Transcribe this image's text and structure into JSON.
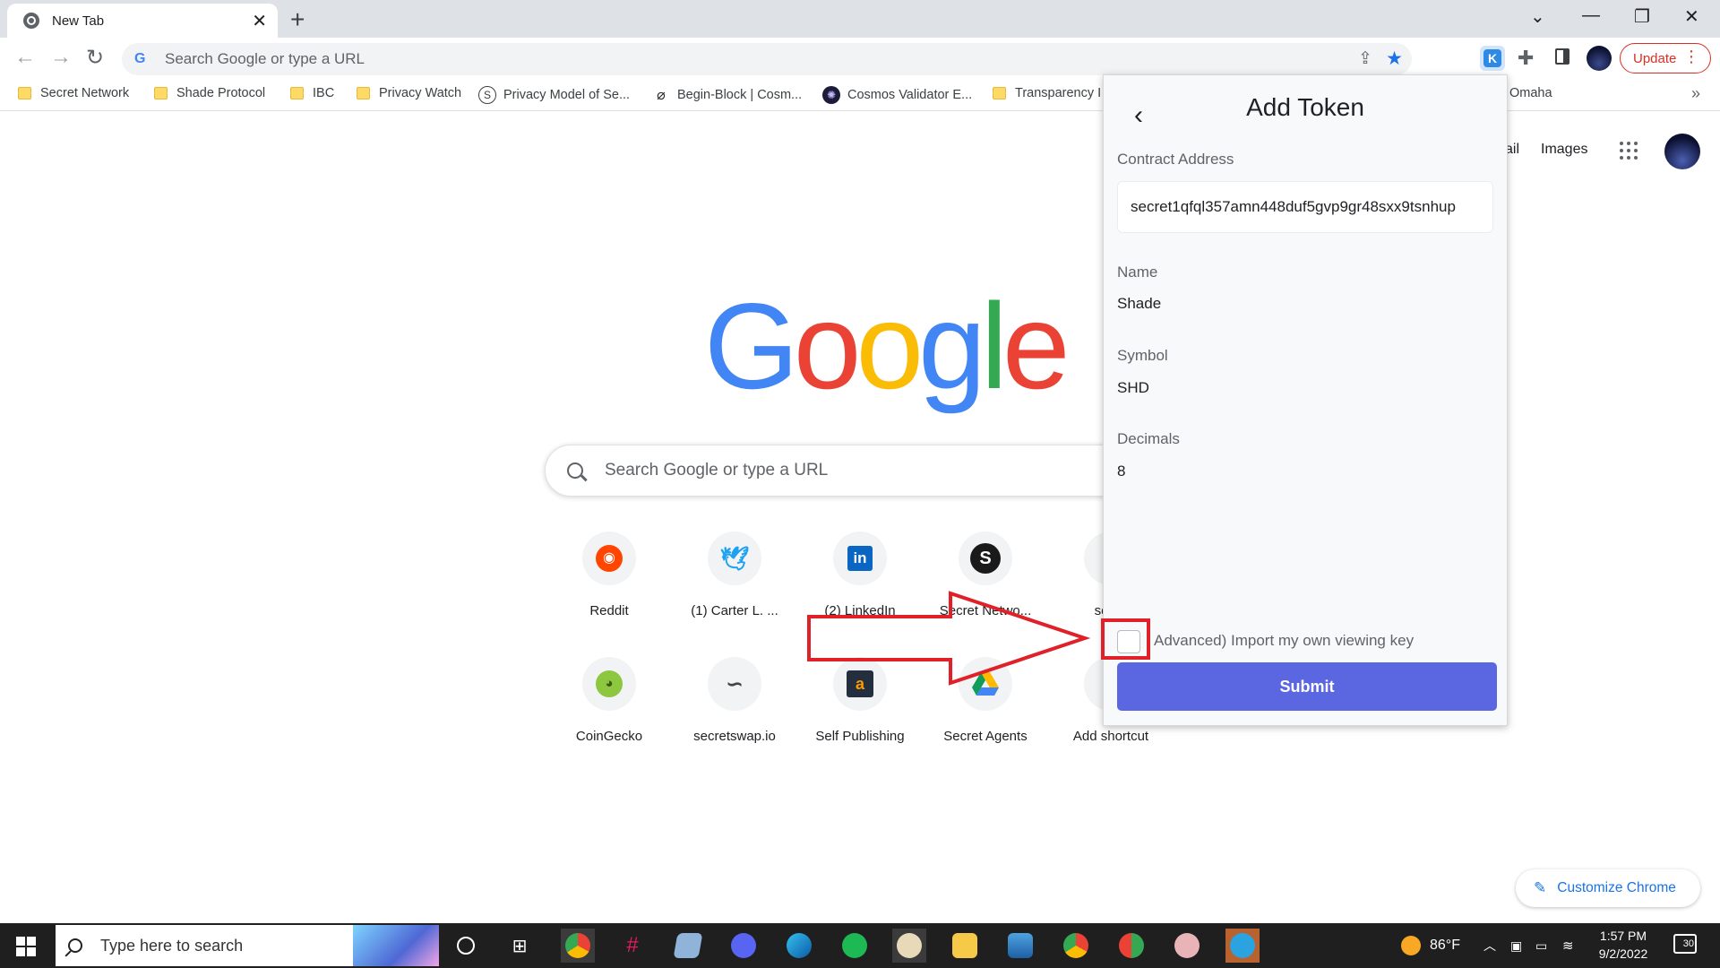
{
  "browser": {
    "tab_title": "New Tab",
    "omnibox_placeholder": "Search Google or type a URL",
    "update_label": "Update",
    "bookmarks": [
      {
        "label": "Secret Network",
        "icon": "folder-icon"
      },
      {
        "label": "Shade Protocol",
        "icon": "folder-icon"
      },
      {
        "label": "IBC",
        "icon": "folder-icon"
      },
      {
        "label": "Privacy Watch",
        "icon": "folder-icon"
      },
      {
        "label": "Privacy Model of Se...",
        "icon": "secret-s-icon"
      },
      {
        "label": "Begin-Block | Cosm...",
        "icon": "begin-block-icon"
      },
      {
        "label": "Cosmos Validator E...",
        "icon": "cosmos-icon"
      },
      {
        "label": "Transparency I",
        "icon": "folder-icon"
      },
      {
        "label": "Omaha",
        "icon": "folder-icon"
      }
    ]
  },
  "ntp": {
    "gmail_label": "ail",
    "images_label": "Images",
    "logo_text": [
      "G",
      "o",
      "o",
      "g",
      "l",
      "e"
    ],
    "search_placeholder": "Search Google or type a URL",
    "shortcuts_row1": [
      {
        "label": "Reddit",
        "icon": "reddit-icon"
      },
      {
        "label": "(1) Carter L. ...",
        "icon": "twitter-icon"
      },
      {
        "label": "(2) LinkedIn",
        "icon": "linkedin-icon"
      },
      {
        "label": "Secret Netwo...",
        "icon": "secret-network-icon"
      },
      {
        "label": "secre",
        "icon": "secret-icon"
      }
    ],
    "shortcuts_row2": [
      {
        "label": "CoinGecko",
        "icon": "coingecko-icon"
      },
      {
        "label": "secretswap.io",
        "icon": "secretswap-icon"
      },
      {
        "label": "Self Publishing",
        "icon": "amazon-icon"
      },
      {
        "label": "Secret Agents",
        "icon": "google-drive-icon"
      },
      {
        "label": "Add shortcut",
        "icon": "add-icon"
      }
    ],
    "customize_label": "Customize Chrome"
  },
  "popup": {
    "title": "Add Token",
    "contract_label": "Contract Address",
    "contract_value": "secret1qfql357amn448duf5gvp9gr48sxx9tsnhup",
    "name_label": "Name",
    "name_value": "Shade",
    "symbol_label": "Symbol",
    "symbol_value": "SHD",
    "decimals_label": "Decimals",
    "decimals_value": "8",
    "advanced_label": "Advanced) Import my own viewing key",
    "submit_label": "Submit"
  },
  "taskbar": {
    "search_placeholder": "Type here to search",
    "weather": "86°F",
    "time": "1:57 PM",
    "date": "9/2/2022",
    "notification_count": "30"
  },
  "colors": {
    "google_blue": "#4285F4",
    "google_red": "#EA4335",
    "google_yellow": "#FBBC05",
    "google_green": "#34A853",
    "submit_button": "#5A67E0",
    "annotation_red": "#E02129"
  }
}
